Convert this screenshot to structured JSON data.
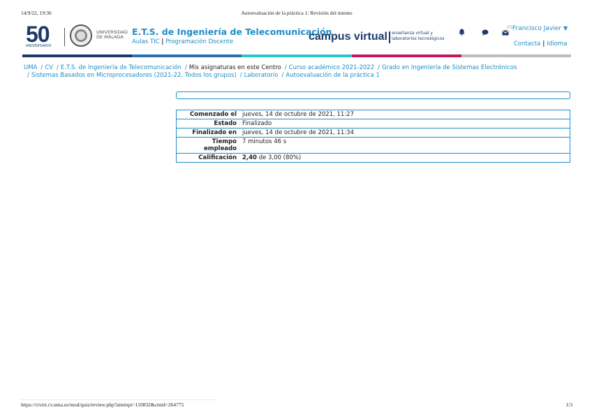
{
  "print": {
    "datetime": "14/9/22, 19:36",
    "title": "Autoevaluación de la práctica 1: Revisión del intento",
    "url": "https://ctvirt.cv.uma.es/mod/quiz/review.php?attempt=110832&cmid=264775",
    "page": "1/3"
  },
  "header": {
    "logo_number": "50",
    "logo_caption": "ANIVERSARIO",
    "university_line1": "UNIVERSIDAD",
    "university_line2": "DE MÁLAGA",
    "school_title": "E.T.S. de Ingeniería de Telecomunicación",
    "link_aulas": "Aulas TIC",
    "link_programacion": "Programación Docente",
    "campus": "campus virtual",
    "campus_sub1": "enseñanza virtual y",
    "campus_sub2": "laboratorios tecnológicos",
    "user_name": "Francisco Javier",
    "user_badge": "(?)",
    "link_contacta": "Contacta",
    "link_idioma": "Idioma",
    "icons": [
      "bell-icon",
      "chat-icon",
      "envelope-icon",
      "chevron-down-icon"
    ]
  },
  "colors": {
    "link": "#1d8ec7",
    "brand_dark": "#1b3a6b",
    "bar": [
      "#1b3a6b",
      "#2c6fb3",
      "#2ec5c9",
      "#c2185b",
      "#bdbdbd"
    ]
  },
  "breadcrumb": [
    {
      "label": "UMA",
      "link": true
    },
    {
      "label": "CV",
      "link": true
    },
    {
      "label": "E.T.S. de Ingeniería de Telecomunicación",
      "link": true
    },
    {
      "label": "Mis asignaturas en este Centro",
      "link": false
    },
    {
      "label": "Curso académico 2021-2022",
      "link": true
    },
    {
      "label": "Grado en Ingeniería de Sistemas Electrónicos",
      "link": true
    },
    {
      "label": "Sistemas Basados en Microprocesadores (2021-22, Todos los grupos)",
      "link": true
    },
    {
      "label": "Laboratorio",
      "link": true
    },
    {
      "label": "Autoevaluación de la práctica 1",
      "link": true
    }
  ],
  "summary": {
    "rows": [
      {
        "label": "Comenzado el",
        "value": "jueves, 14 de octubre de 2021, 11:27"
      },
      {
        "label": "Estado",
        "value": "Finalizado"
      },
      {
        "label": "Finalizado en",
        "value": "jueves, 14 de octubre de 2021, 11:34"
      },
      {
        "label": "Tiempo empleado",
        "value": "7 minutos 46 s"
      }
    ],
    "grade_label": "Calificación",
    "grade_value": "2,40",
    "grade_rest": "de 3,00 (80%)"
  }
}
